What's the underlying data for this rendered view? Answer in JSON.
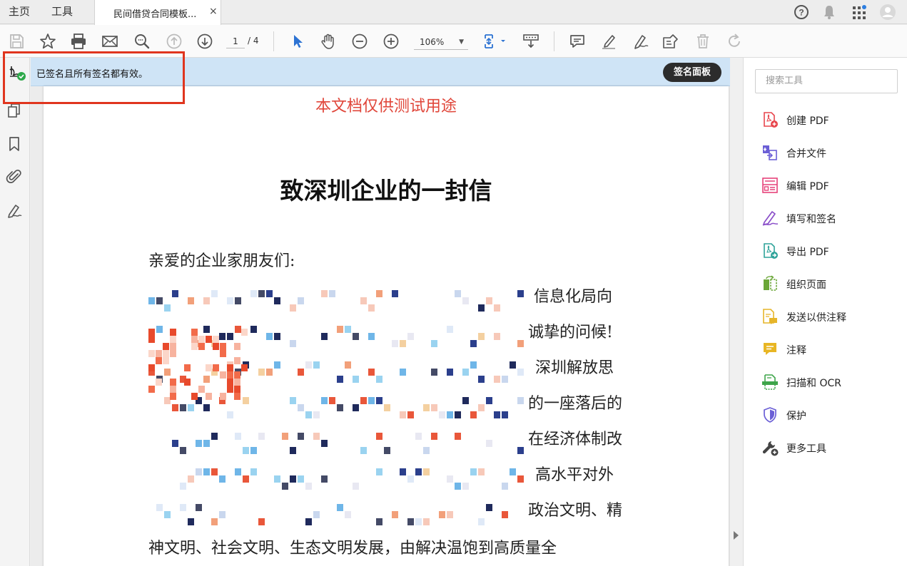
{
  "tabs": {
    "home": "主页",
    "tools": "工具",
    "document": "民间借贷合同模板...",
    "close": "×"
  },
  "toolbar": {
    "current_page": "1",
    "total_pages": "/ 4",
    "zoom": "106%",
    "zoom_caret": "▼"
  },
  "signature_bar": {
    "status": "已签名且所有签名都有效。",
    "panel_button": "签名面板"
  },
  "document": {
    "watermark": "本文档仅供测试用途",
    "title": "致深圳企业的一封信",
    "salutation": "亲爱的企业家朋友们:",
    "line_tails": [
      "信息化局向",
      "诚挚的问候!",
      "深圳解放思",
      "的一座落后的",
      "在经济体制改",
      "高水平对外",
      "政治文明、精"
    ],
    "last_line": "神文明、社会文明、生态文明发展，由解决温饱到高质量全"
  },
  "tools_panel": {
    "search_placeholder": "搜索工具",
    "items": [
      {
        "label": "创建 PDF",
        "icon": "create-pdf-icon",
        "color": "#e8454c"
      },
      {
        "label": "合并文件",
        "icon": "combine-files-icon",
        "color": "#6b5fd6"
      },
      {
        "label": "编辑 PDF",
        "icon": "edit-pdf-icon",
        "color": "#e6427a"
      },
      {
        "label": "填写和签名",
        "icon": "fill-sign-icon",
        "color": "#8a4fc9"
      },
      {
        "label": "导出 PDF",
        "icon": "export-pdf-icon",
        "color": "#2fa39a"
      },
      {
        "label": "组织页面",
        "icon": "organize-pages-icon",
        "color": "#6aa637"
      },
      {
        "label": "发送以供注释",
        "icon": "send-for-comments-icon",
        "color": "#e6b52a"
      },
      {
        "label": "注释",
        "icon": "comment-icon",
        "color": "#e8b624"
      },
      {
        "label": "扫描和 OCR",
        "icon": "scan-ocr-icon",
        "color": "#3ea54a"
      },
      {
        "label": "保护",
        "icon": "protect-icon",
        "color": "#6b5fd6"
      },
      {
        "label": "更多工具",
        "icon": "more-tools-icon",
        "color": "#444444"
      }
    ]
  }
}
